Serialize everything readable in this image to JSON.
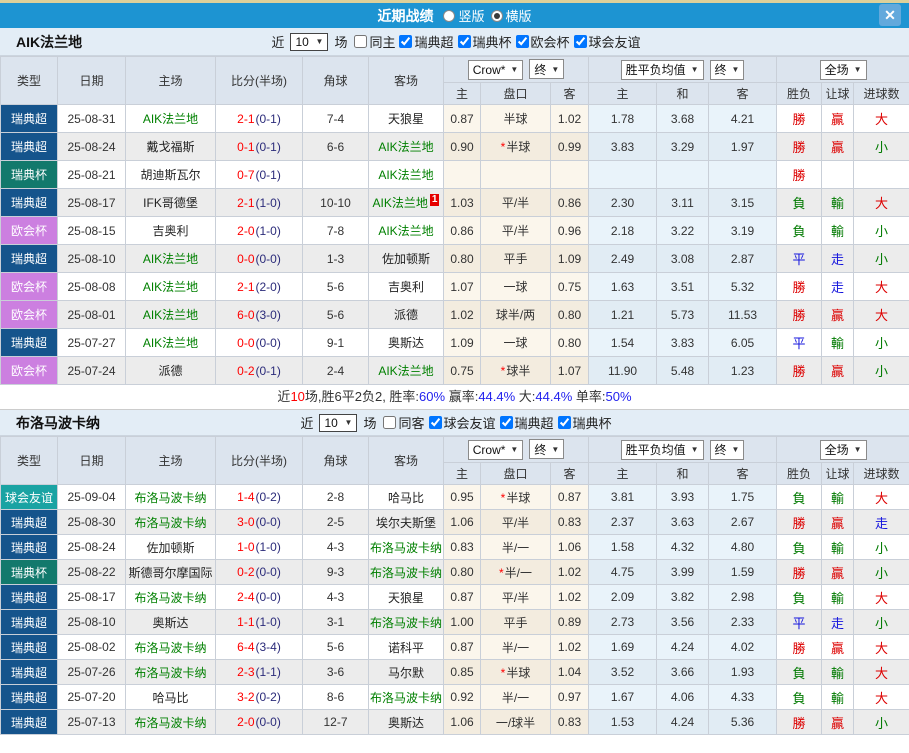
{
  "titlebar": {
    "title": "近期战绩",
    "radio_options": [
      {
        "label": "竖版",
        "selected": false
      },
      {
        "label": "横版",
        "selected": true
      }
    ],
    "close_icon": "✕"
  },
  "colors": {
    "titlebar_bg": "#1d94d2",
    "top_strip": "#ddd09a",
    "close_bg": "#63a9dc",
    "filter_bg": "#e3edf6",
    "header_bg": "#dce4ee",
    "row_odd": "#ffffff",
    "row_even": "#ececec",
    "handicap_odd": "#fbf6ec",
    "handicap_even": "#f3ecdf",
    "europe_odd": "#e9f3fa",
    "europe_even": "#e1ecf4",
    "score_main": "#ff0000",
    "score_half": "#2b2b7a",
    "team_green": "#008000",
    "res_red": "#dd0000",
    "res_green": "#007a00",
    "res_blue": "#1515dd"
  },
  "type_colors": {
    "瑞典超": "#15548c",
    "瑞典杯": "#12796c",
    "欧会杯": "#cc7fe0",
    "球会友谊": "#1aa3a3"
  },
  "result_color_map": {
    "勝": "red",
    "贏": "red",
    "大": "red",
    "負": "green",
    "輸": "green",
    "小": "green",
    "平": "blue",
    "走": "blue"
  },
  "table": {
    "columns": [
      "类型",
      "日期",
      "主场",
      "比分(半场)",
      "角球",
      "客场"
    ],
    "sub_columns": [
      "主",
      "盘口",
      "客",
      "主",
      "和",
      "客",
      "胜负",
      "让球",
      "进球数"
    ],
    "dropdowns": {
      "bookmaker": "Crow*",
      "bookmaker_time": "终",
      "odds_avg": "胜平负均值",
      "odds_time": "终",
      "scope": "全场"
    }
  },
  "sections": [
    {
      "team": "AIK法兰地",
      "filter": {
        "recent_label": "近",
        "count": "10",
        "matches_label": "场",
        "checkboxes": [
          {
            "label": "同主",
            "checked": false
          },
          {
            "label": "瑞典超",
            "checked": true
          },
          {
            "label": "瑞典杯",
            "checked": true
          },
          {
            "label": "欧会杯",
            "checked": true
          },
          {
            "label": "球会友谊",
            "checked": true
          }
        ]
      },
      "rows": [
        {
          "type": "瑞典超",
          "date": "25-08-31",
          "home": "AIK法兰地",
          "home_green": true,
          "score": "2-1",
          "half": "(0-1)",
          "corner": "7-4",
          "away": "天狼星",
          "away_green": false,
          "away_card": "",
          "ah": [
            "0.87",
            "半球",
            "1.02"
          ],
          "ah_star": false,
          "eu": [
            "1.78",
            "3.68",
            "4.21"
          ],
          "results": [
            "勝",
            "贏",
            "大"
          ]
        },
        {
          "type": "瑞典超",
          "date": "25-08-24",
          "home": "戴戈福斯",
          "home_green": false,
          "score": "0-1",
          "half": "(0-1)",
          "corner": "6-6",
          "away": "AIK法兰地",
          "away_green": true,
          "away_card": "",
          "ah": [
            "0.90",
            "半球",
            "0.99"
          ],
          "ah_star": true,
          "eu": [
            "3.83",
            "3.29",
            "1.97"
          ],
          "results": [
            "勝",
            "贏",
            "小"
          ]
        },
        {
          "type": "瑞典杯",
          "date": "25-08-21",
          "home": "胡迪斯瓦尔",
          "home_green": false,
          "score": "0-7",
          "half": "(0-1)",
          "corner": "",
          "away": "AIK法兰地",
          "away_green": true,
          "away_card": "",
          "ah": [
            "",
            "",
            ""
          ],
          "ah_star": false,
          "eu": [
            "",
            "",
            ""
          ],
          "results": [
            "勝",
            "",
            ""
          ]
        },
        {
          "type": "瑞典超",
          "date": "25-08-17",
          "home": "IFK哥德堡",
          "home_green": false,
          "score": "2-1",
          "half": "(1-0)",
          "corner": "10-10",
          "away": "AIK法兰地",
          "away_green": true,
          "away_card": "1",
          "ah": [
            "1.03",
            "平/半",
            "0.86"
          ],
          "ah_star": false,
          "eu": [
            "2.30",
            "3.11",
            "3.15"
          ],
          "results": [
            "負",
            "輸",
            "大"
          ]
        },
        {
          "type": "欧会杯",
          "date": "25-08-15",
          "home": "吉奥利",
          "home_green": false,
          "score": "2-0",
          "half": "(1-0)",
          "corner": "7-8",
          "away": "AIK法兰地",
          "away_green": true,
          "away_card": "",
          "ah": [
            "0.86",
            "平/半",
            "0.96"
          ],
          "ah_star": false,
          "eu": [
            "2.18",
            "3.22",
            "3.19"
          ],
          "results": [
            "負",
            "輸",
            "小"
          ]
        },
        {
          "type": "瑞典超",
          "date": "25-08-10",
          "home": "AIK法兰地",
          "home_green": true,
          "score": "0-0",
          "half": "(0-0)",
          "corner": "1-3",
          "away": "佐加顿斯",
          "away_green": false,
          "away_card": "",
          "ah": [
            "0.80",
            "平手",
            "1.09"
          ],
          "ah_star": false,
          "eu": [
            "2.49",
            "3.08",
            "2.87"
          ],
          "results": [
            "平",
            "走",
            "小"
          ]
        },
        {
          "type": "欧会杯",
          "date": "25-08-08",
          "home": "AIK法兰地",
          "home_green": true,
          "score": "2-1",
          "half": "(2-0)",
          "corner": "5-6",
          "away": "吉奥利",
          "away_green": false,
          "away_card": "",
          "ah": [
            "1.07",
            "一球",
            "0.75"
          ],
          "ah_star": false,
          "eu": [
            "1.63",
            "3.51",
            "5.32"
          ],
          "results": [
            "勝",
            "走",
            "大"
          ]
        },
        {
          "type": "欧会杯",
          "date": "25-08-01",
          "home": "AIK法兰地",
          "home_green": true,
          "score": "6-0",
          "half": "(3-0)",
          "corner": "5-6",
          "away": "派德",
          "away_green": false,
          "away_card": "",
          "ah": [
            "1.02",
            "球半/两",
            "0.80"
          ],
          "ah_star": false,
          "eu": [
            "1.21",
            "5.73",
            "11.53"
          ],
          "results": [
            "勝",
            "贏",
            "大"
          ]
        },
        {
          "type": "瑞典超",
          "date": "25-07-27",
          "home": "AIK法兰地",
          "home_green": true,
          "score": "0-0",
          "half": "(0-0)",
          "corner": "9-1",
          "away": "奥斯达",
          "away_green": false,
          "away_card": "",
          "ah": [
            "1.09",
            "一球",
            "0.80"
          ],
          "ah_star": false,
          "eu": [
            "1.54",
            "3.83",
            "6.05"
          ],
          "results": [
            "平",
            "輸",
            "小"
          ]
        },
        {
          "type": "欧会杯",
          "date": "25-07-24",
          "home": "派德",
          "home_green": false,
          "score": "0-2",
          "half": "(0-1)",
          "corner": "2-4",
          "away": "AIK法兰地",
          "away_green": true,
          "away_card": "",
          "ah": [
            "0.75",
            "球半",
            "1.07"
          ],
          "ah_star": true,
          "eu": [
            "11.90",
            "5.48",
            "1.23"
          ],
          "results": [
            "勝",
            "贏",
            "小"
          ]
        }
      ],
      "summary_segments": [
        {
          "t": "近",
          "c": "dark"
        },
        {
          "t": "10",
          "c": "red"
        },
        {
          "t": "场,胜6平2负2, 胜率:",
          "c": "dark"
        },
        {
          "t": "60%",
          "c": "blue"
        },
        {
          "t": " 赢率:",
          "c": "dark"
        },
        {
          "t": "44.4%",
          "c": "blue"
        },
        {
          "t": " 大:",
          "c": "dark"
        },
        {
          "t": "44.4%",
          "c": "blue"
        },
        {
          "t": " 单率:",
          "c": "dark"
        },
        {
          "t": "50%",
          "c": "blue"
        }
      ]
    },
    {
      "team": "布洛马波卡纳",
      "filter": {
        "recent_label": "近",
        "count": "10",
        "matches_label": "场",
        "checkboxes": [
          {
            "label": "同客",
            "checked": false
          },
          {
            "label": "球会友谊",
            "checked": true
          },
          {
            "label": "瑞典超",
            "checked": true
          },
          {
            "label": "瑞典杯",
            "checked": true
          }
        ]
      },
      "rows": [
        {
          "type": "球会友谊",
          "date": "25-09-04",
          "home": "布洛马波卡纳",
          "home_green": true,
          "score": "1-4",
          "half": "(0-2)",
          "corner": "2-8",
          "away": "哈马比",
          "away_green": false,
          "away_card": "",
          "ah": [
            "0.95",
            "半球",
            "0.87"
          ],
          "ah_star": true,
          "eu": [
            "3.81",
            "3.93",
            "1.75"
          ],
          "results": [
            "負",
            "輸",
            "大"
          ]
        },
        {
          "type": "瑞典超",
          "date": "25-08-30",
          "home": "布洛马波卡纳",
          "home_green": true,
          "score": "3-0",
          "half": "(0-0)",
          "corner": "2-5",
          "away": "埃尔夫斯堡",
          "away_green": false,
          "away_card": "",
          "ah": [
            "1.06",
            "平/半",
            "0.83"
          ],
          "ah_star": false,
          "eu": [
            "2.37",
            "3.63",
            "2.67"
          ],
          "results": [
            "勝",
            "贏",
            "走"
          ]
        },
        {
          "type": "瑞典超",
          "date": "25-08-24",
          "home": "佐加顿斯",
          "home_green": false,
          "score": "1-0",
          "half": "(1-0)",
          "corner": "4-3",
          "away": "布洛马波卡纳",
          "away_green": true,
          "away_card": "",
          "ah": [
            "0.83",
            "半/一",
            "1.06"
          ],
          "ah_star": false,
          "eu": [
            "1.58",
            "4.32",
            "4.80"
          ],
          "results": [
            "負",
            "輸",
            "小"
          ]
        },
        {
          "type": "瑞典杯",
          "date": "25-08-22",
          "home": "斯德哥尔摩国际",
          "home_green": false,
          "score": "0-2",
          "half": "(0-0)",
          "corner": "9-3",
          "away": "布洛马波卡纳",
          "away_green": true,
          "away_card": "",
          "ah": [
            "0.80",
            "半/一",
            "1.02"
          ],
          "ah_star": true,
          "eu": [
            "4.75",
            "3.99",
            "1.59"
          ],
          "results": [
            "勝",
            "贏",
            "小"
          ]
        },
        {
          "type": "瑞典超",
          "date": "25-08-17",
          "home": "布洛马波卡纳",
          "home_green": true,
          "score": "2-4",
          "half": "(0-0)",
          "corner": "4-3",
          "away": "天狼星",
          "away_green": false,
          "away_card": "",
          "ah": [
            "0.87",
            "平/半",
            "1.02"
          ],
          "ah_star": false,
          "eu": [
            "2.09",
            "3.82",
            "2.98"
          ],
          "results": [
            "負",
            "輸",
            "大"
          ]
        },
        {
          "type": "瑞典超",
          "date": "25-08-10",
          "home": "奥斯达",
          "home_green": false,
          "score": "1-1",
          "half": "(1-0)",
          "corner": "3-1",
          "away": "布洛马波卡纳",
          "away_green": true,
          "away_card": "",
          "ah": [
            "1.00",
            "平手",
            "0.89"
          ],
          "ah_star": false,
          "eu": [
            "2.73",
            "3.56",
            "2.33"
          ],
          "results": [
            "平",
            "走",
            "小"
          ]
        },
        {
          "type": "瑞典超",
          "date": "25-08-02",
          "home": "布洛马波卡纳",
          "home_green": true,
          "score": "6-4",
          "half": "(3-4)",
          "corner": "5-6",
          "away": "诺科平",
          "away_green": false,
          "away_card": "",
          "ah": [
            "0.87",
            "半/一",
            "1.02"
          ],
          "ah_star": false,
          "eu": [
            "1.69",
            "4.24",
            "4.02"
          ],
          "results": [
            "勝",
            "贏",
            "大"
          ]
        },
        {
          "type": "瑞典超",
          "date": "25-07-26",
          "home": "布洛马波卡纳",
          "home_green": true,
          "score": "2-3",
          "half": "(1-1)",
          "corner": "3-6",
          "away": "马尔默",
          "away_green": false,
          "away_card": "",
          "ah": [
            "0.85",
            "半球",
            "1.04"
          ],
          "ah_star": true,
          "eu": [
            "3.52",
            "3.66",
            "1.93"
          ],
          "results": [
            "負",
            "輸",
            "大"
          ]
        },
        {
          "type": "瑞典超",
          "date": "25-07-20",
          "home": "哈马比",
          "home_green": false,
          "score": "3-2",
          "half": "(0-2)",
          "corner": "8-6",
          "away": "布洛马波卡纳",
          "away_green": true,
          "away_card": "",
          "ah": [
            "0.92",
            "半/一",
            "0.97"
          ],
          "ah_star": false,
          "eu": [
            "1.67",
            "4.06",
            "4.33"
          ],
          "results": [
            "負",
            "輸",
            "大"
          ]
        },
        {
          "type": "瑞典超",
          "date": "25-07-13",
          "home": "布洛马波卡纳",
          "home_green": true,
          "score": "2-0",
          "half": "(0-0)",
          "corner": "12-7",
          "away": "奥斯达",
          "away_green": false,
          "away_card": "",
          "ah": [
            "1.06",
            "一/球半",
            "0.83"
          ],
          "ah_star": false,
          "eu": [
            "1.53",
            "4.24",
            "5.36"
          ],
          "results": [
            "勝",
            "贏",
            "小"
          ]
        }
      ],
      "summary_segments": []
    }
  ]
}
